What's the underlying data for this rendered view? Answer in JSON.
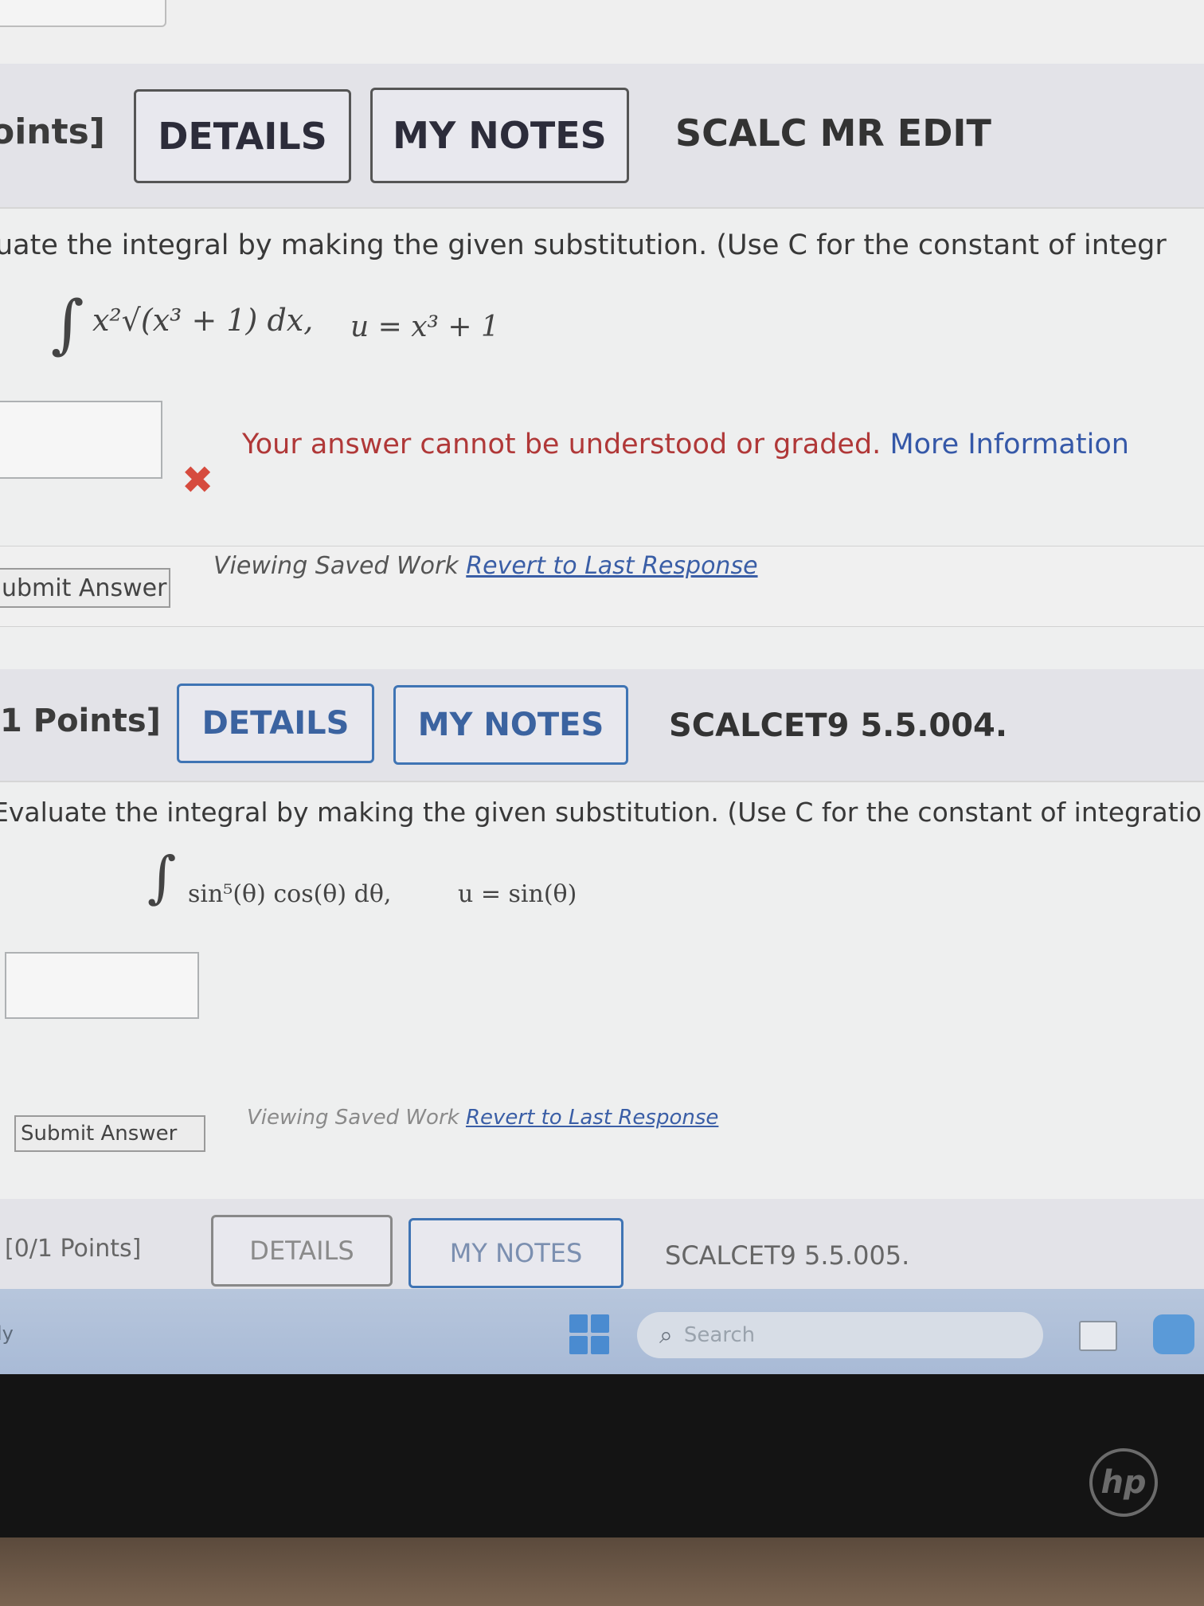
{
  "q1": {
    "points_label": "oints]",
    "details_label": "DETAILS",
    "notes_label": "MY NOTES",
    "code": "SCALC MR EDIT",
    "instruction": "uate the integral by making the given substitution. (Use C for the constant of integr",
    "integral": {
      "integrand": "x²√(x³ + 1) dx,",
      "substitution": "u = x³ + 1"
    },
    "answer_value": "",
    "error_text": "Your answer cannot be understood or graded.",
    "error_link": "More Information",
    "submit_label": "ubmit Answer",
    "saved_text": "Viewing Saved Work",
    "revert_label": "Revert to Last Response"
  },
  "q2": {
    "points_label": "1 Points]",
    "details_label": "DETAILS",
    "notes_label": "MY NOTES",
    "code": "SCALCET9 5.5.004.",
    "instruction": "Evaluate the integral by making the given substitution. (Use C for the constant of integratio",
    "integral": {
      "integrand": "sin⁵(θ) cos(θ) dθ,",
      "substitution": "u = sin(θ)"
    },
    "answer_value": "",
    "submit_label": "Submit Answer",
    "saved_text": "Viewing Saved Work",
    "revert_label": "Revert to Last Response"
  },
  "q3": {
    "points_label": "[0/1 Points]",
    "details_label": "DETAILS",
    "notes_label": "MY NOTES",
    "code": "SCALCET9 5.5.005."
  },
  "taskbar": {
    "left_text": "ly",
    "search_placeholder": "Search"
  },
  "brand": "hp",
  "colors": {
    "error": "#b03838",
    "link": "#3558a8",
    "x_mark": "#d64b3e",
    "header_bg": "#e3e3e8"
  }
}
